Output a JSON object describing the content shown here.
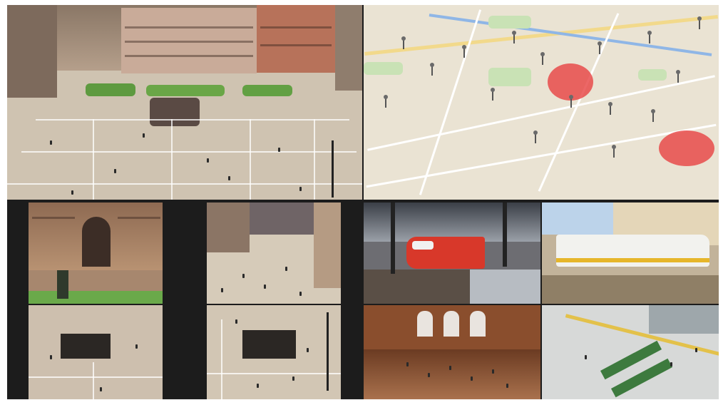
{
  "wall": {
    "tiles": [
      {
        "id": "piazza-aerial",
        "kind": "camera-feed",
        "scene": "square-overview"
      },
      {
        "id": "city-map",
        "kind": "map",
        "hotspot_color": "#e84646",
        "hotspots": 2
      },
      {
        "id": "palace-gate",
        "kind": "camera-feed",
        "scene": "building-entrance"
      },
      {
        "id": "square-street",
        "kind": "camera-feed",
        "scene": "street-corner"
      },
      {
        "id": "train-station",
        "kind": "camera-feed",
        "scene": "platform-train"
      },
      {
        "id": "tram-stop",
        "kind": "camera-feed",
        "scene": "tram"
      },
      {
        "id": "square-entrance-a",
        "kind": "camera-feed",
        "scene": "stair-entrance"
      },
      {
        "id": "square-entrance-b",
        "kind": "camera-feed",
        "scene": "stair-entrance"
      },
      {
        "id": "station-hall",
        "kind": "camera-feed",
        "scene": "concourse"
      },
      {
        "id": "terminal-gates",
        "kind": "camera-feed",
        "scene": "waiting-area"
      }
    ]
  }
}
